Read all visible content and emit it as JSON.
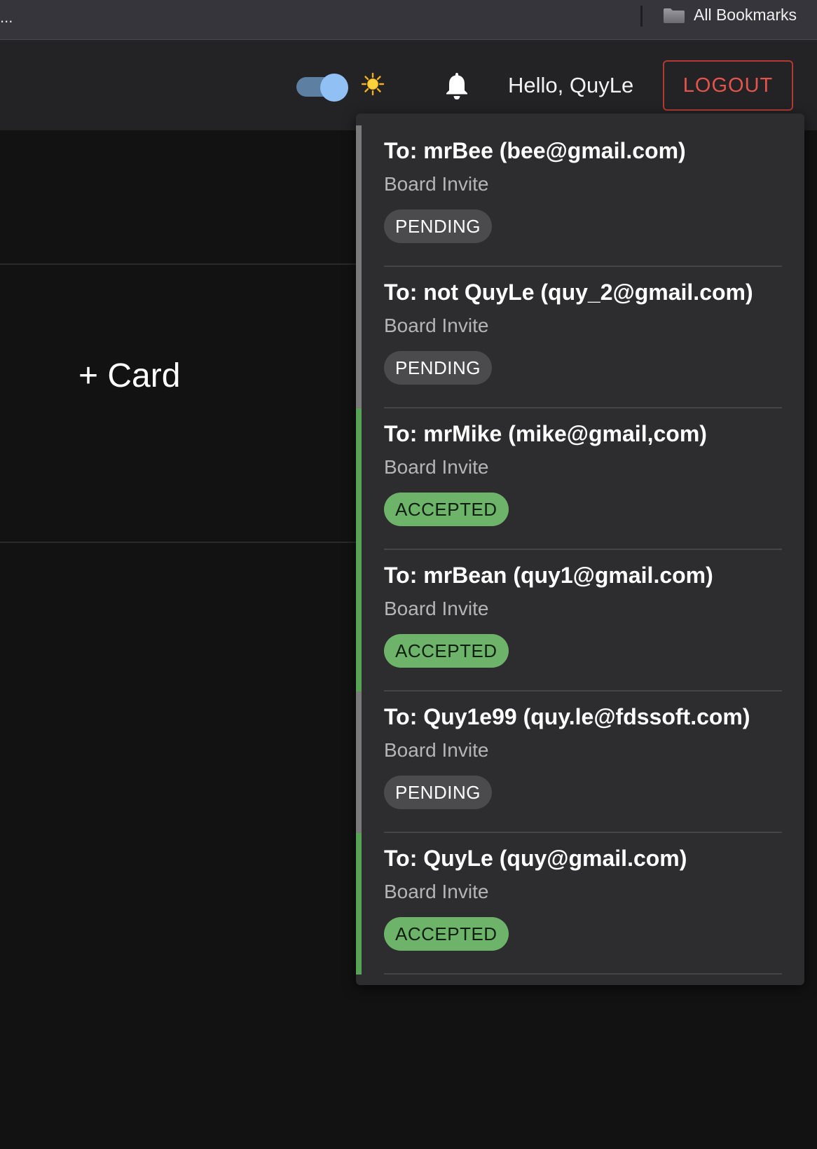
{
  "bookmarks_bar": {
    "overflow": "...",
    "folder_label": "All Bookmarks",
    "icon": "folder-icon"
  },
  "header": {
    "theme_toggle_on": true,
    "theme_icon": "sun-icon",
    "notification_icon": "bell-icon",
    "greeting": "Hello, QuyLe",
    "logout_label": "LOGOUT"
  },
  "board": {
    "add_card_label": "+ Card"
  },
  "colors": {
    "accepted": "#6db46a",
    "pending": "#4b4b4d",
    "logout": "#e5544c",
    "toggle_knob": "#91c1f4"
  },
  "notifications": [
    {
      "recipient": "To: mrBee (bee@gmail.com)",
      "type": "Board Invite",
      "status": "PENDING"
    },
    {
      "recipient": "To: not QuyLe (quy_2@gmail.com)",
      "type": "Board Invite",
      "status": "PENDING"
    },
    {
      "recipient": "To: mrMike (mike@gmail,com)",
      "type": "Board Invite",
      "status": "ACCEPTED"
    },
    {
      "recipient": "To: mrBean (quy1@gmail.com)",
      "type": "Board Invite",
      "status": "ACCEPTED"
    },
    {
      "recipient": "To: Quy1e99 (quy.le@fdssoft.com)",
      "type": "Board Invite",
      "status": "PENDING"
    },
    {
      "recipient": "To: QuyLe (quy@gmail.com)",
      "type": "Board Invite",
      "status": "ACCEPTED"
    }
  ]
}
